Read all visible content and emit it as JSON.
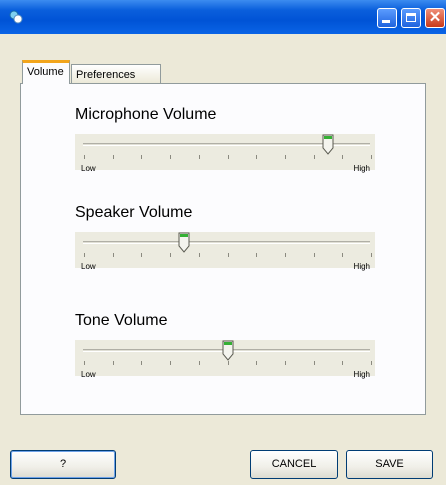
{
  "tabs": [
    {
      "label": "Volume",
      "active": true
    },
    {
      "label": "Preferences",
      "active": false
    }
  ],
  "sliders": [
    {
      "label": "Microphone Volume",
      "low_label": "Low",
      "high_label": "High",
      "value": 0.85
    },
    {
      "label": "Speaker Volume",
      "low_label": "Low",
      "high_label": "High",
      "value": 0.35
    },
    {
      "label": "Tone Volume",
      "low_label": "Low",
      "high_label": "High",
      "value": 0.5
    }
  ],
  "buttons": {
    "help_label": "?",
    "cancel_label": "CANCEL",
    "save_label": "SAVE"
  },
  "icons": {
    "app": "app-icon",
    "minimize": "minimize-icon",
    "maximize": "maximize-icon",
    "close": "close-icon"
  }
}
